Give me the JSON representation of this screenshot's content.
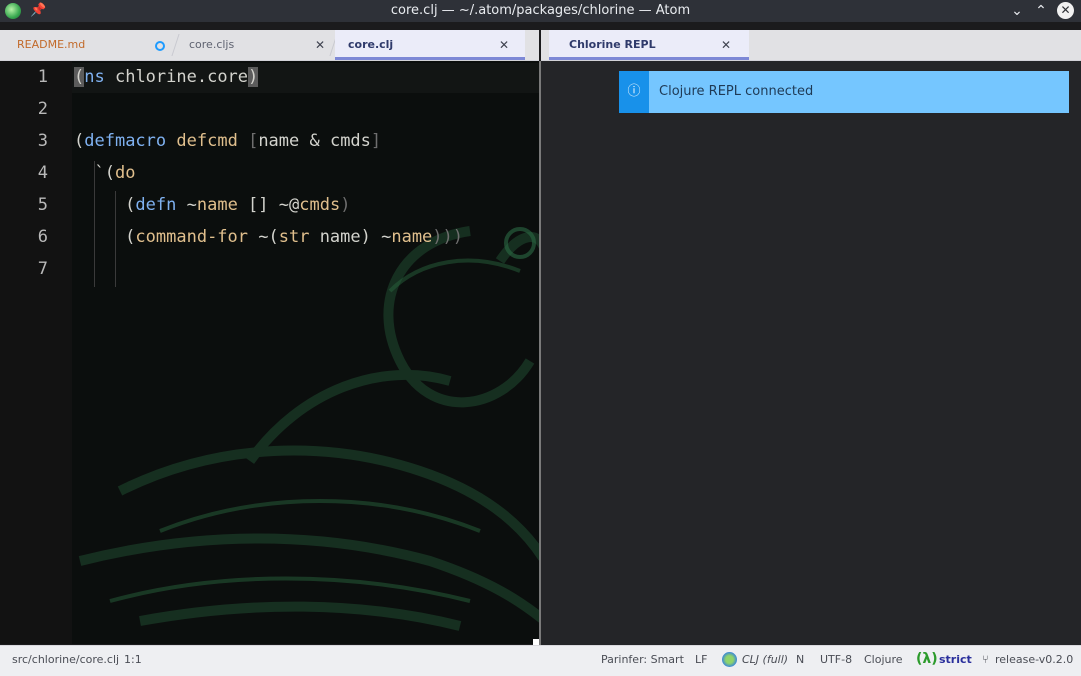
{
  "window": {
    "title": "core.clj — ~/.atom/packages/chlorine — Atom"
  },
  "tabs_left": [
    {
      "label": "README.md",
      "modified": true
    },
    {
      "label": "core.cljs"
    },
    {
      "label": "core.clj",
      "active": true
    }
  ],
  "tabs_right": [
    {
      "label": "Chlorine REPL",
      "active": true
    }
  ],
  "editor": {
    "line_numbers": [
      "1",
      "2",
      "3",
      "4",
      "5",
      "6",
      "7"
    ]
  },
  "notification": {
    "message": "Clojure REPL connected",
    "type": "info"
  },
  "statusbar": {
    "file_path": "src/chlorine/core.clj",
    "cursor": "1:1",
    "parinfer": "Parinfer: Smart",
    "line_ending": "LF",
    "repl_mode": "CLJ (full)",
    "n": "N",
    "encoding": "UTF-8",
    "grammar": "Clojure",
    "lambda": "(λ)",
    "strict": "strict",
    "branch": "release-v0.2.0"
  },
  "colors": {
    "accent": "#7d88d6",
    "info": "#1891ea",
    "info_bg": "#75c6ff"
  }
}
